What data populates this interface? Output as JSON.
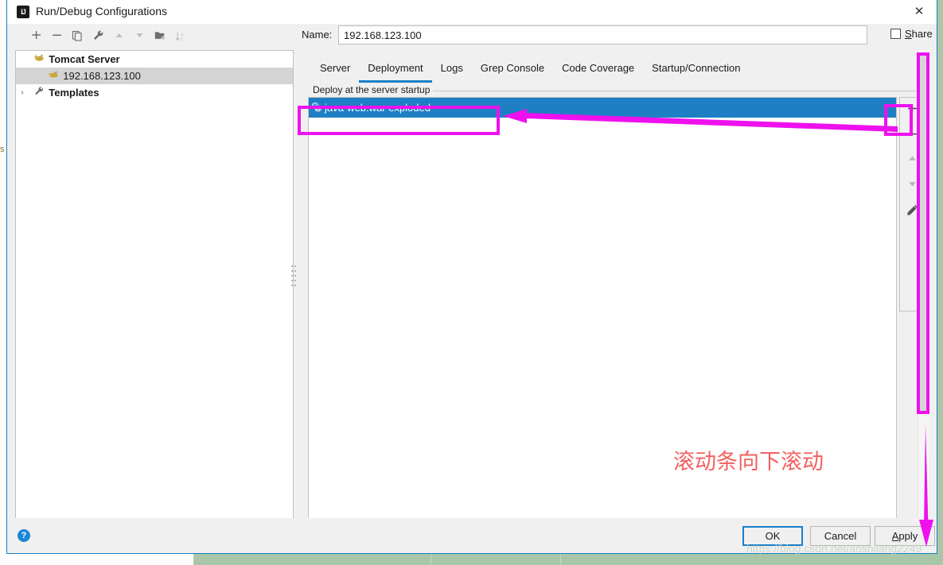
{
  "window": {
    "title": "Run/Debug Configurations",
    "app_icon": "intellij-idea-icon",
    "close_label": "✕"
  },
  "tree_toolbar": {
    "items": [
      {
        "name": "add-configuration-button",
        "glyph": "+",
        "enabled": true
      },
      {
        "name": "remove-configuration-button",
        "glyph": "−",
        "enabled": true
      },
      {
        "name": "copy-configuration-button",
        "glyph": "❐",
        "enabled": true
      },
      {
        "name": "edit-templates-button",
        "glyph": "🔧",
        "enabled": true
      },
      {
        "name": "move-up-button",
        "glyph": "▲",
        "enabled": false
      },
      {
        "name": "move-down-button",
        "glyph": "▼",
        "enabled": false
      },
      {
        "name": "new-folder-button",
        "glyph": "📁",
        "enabled": true
      },
      {
        "name": "sort-configurations-button",
        "glyph": "↓ᴀᴢ",
        "enabled": false
      }
    ]
  },
  "tree": {
    "nodes": [
      {
        "label": "Tomcat Server",
        "icon": "tomcat-icon",
        "expanded": true,
        "arrow": "ⱟ",
        "bold": true,
        "selected": false
      },
      {
        "label": "192.168.123.100",
        "icon": "tomcat-icon",
        "expanded": null,
        "arrow": "",
        "bold": false,
        "selected": true
      },
      {
        "label": "Templates",
        "icon": "wrench-icon",
        "expanded": false,
        "arrow": "›",
        "bold": true,
        "selected": false
      }
    ]
  },
  "name_field": {
    "label": "Name:",
    "value": "192.168.123.100",
    "placeholder": "Name"
  },
  "share": {
    "label": "Share",
    "mnemonic": "S",
    "rest": "hare",
    "checked": false
  },
  "tabs": [
    {
      "label": "Server",
      "active": false
    },
    {
      "label": "Deployment",
      "active": true
    },
    {
      "label": "Logs",
      "active": false
    },
    {
      "label": "Grep Console",
      "active": false
    },
    {
      "label": "Code Coverage",
      "active": false
    },
    {
      "label": "Startup/Connection",
      "active": false
    }
  ],
  "deployment": {
    "group_label": "Deploy at the server startup",
    "rows": [
      {
        "label": "java-web:war exploded",
        "icon": "artifact-icon",
        "selected": true
      }
    ],
    "side_buttons": [
      {
        "name": "add-artifact-button",
        "glyph": "+",
        "enabled": true
      },
      {
        "name": "remove-artifact-button",
        "glyph": "−",
        "enabled": true
      },
      {
        "name": "move-artifact-up-button",
        "glyph": "▲",
        "enabled": false
      },
      {
        "name": "move-artifact-down-button",
        "glyph": "▼",
        "enabled": false
      },
      {
        "name": "edit-artifact-button",
        "glyph": "✎",
        "enabled": true
      }
    ]
  },
  "footer": {
    "help": "?",
    "ok": "OK",
    "cancel": "Cancel",
    "apply_mnemonic": "A",
    "apply_rest": "pply"
  },
  "annotations": {
    "note_cn": "滚动条向下滚动",
    "highlight_color": "#ee11ee",
    "note_color": "#f26161",
    "watermark": "https://blog.csdn.net/aoshilang2249"
  },
  "background": {
    "edge_text": "s",
    "desktop_color": "#a9c6a8"
  }
}
